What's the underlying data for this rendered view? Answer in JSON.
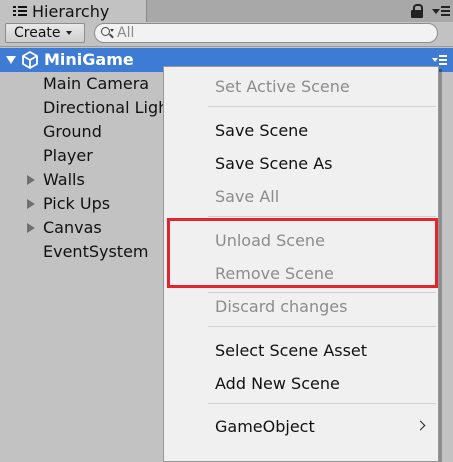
{
  "panel": {
    "tab_title": "Hierarchy"
  },
  "toolbar": {
    "create_label": "Create",
    "search_placeholder": "All"
  },
  "scene": {
    "name": "MiniGame"
  },
  "hierarchy": {
    "items": [
      {
        "label": "Main Camera",
        "has_children": false
      },
      {
        "label": "Directional Light",
        "has_children": false
      },
      {
        "label": "Ground",
        "has_children": false
      },
      {
        "label": "Player",
        "has_children": false
      },
      {
        "label": "Walls",
        "has_children": true
      },
      {
        "label": "Pick Ups",
        "has_children": true
      },
      {
        "label": "Canvas",
        "has_children": true
      },
      {
        "label": "EventSystem",
        "has_children": false
      }
    ]
  },
  "context_menu": {
    "items": [
      {
        "label": "Set Active Scene",
        "enabled": false
      },
      {
        "label": "Save Scene",
        "enabled": true
      },
      {
        "label": "Save Scene As",
        "enabled": true
      },
      {
        "label": "Save All",
        "enabled": false
      },
      {
        "label": "Unload Scene",
        "enabled": false
      },
      {
        "label": "Remove Scene",
        "enabled": false
      },
      {
        "label": "Discard changes",
        "enabled": false
      },
      {
        "label": "Select Scene Asset",
        "enabled": true
      },
      {
        "label": "Add New Scene",
        "enabled": true
      },
      {
        "label": "GameObject",
        "enabled": true,
        "has_submenu": true
      }
    ]
  },
  "colors": {
    "selection": "#3e7bd4",
    "panel_bg": "#c2c2c2",
    "menu_bg": "#f0f0f0",
    "disabled_text": "#8c8c8c",
    "annotation_red": "#e0262e"
  }
}
